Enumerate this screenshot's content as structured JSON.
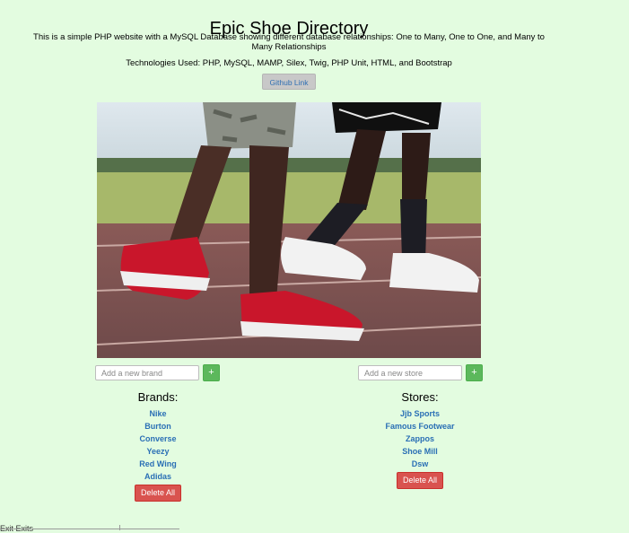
{
  "header": {
    "title": "Epic Shoe Directory",
    "description": "This is a simple PHP website with a MySQL Database showing different database relationships: One to Many, One to One, and Many to Many Relationships",
    "technologies": "Technologies Used: PHP, MySQL, MAMP, Silex, Twig, PHP Unit, HTML, and Bootstrap",
    "github_label": "Github Link"
  },
  "forms": {
    "brand_placeholder": "Add a new brand",
    "store_placeholder": "Add a new store",
    "add_label": "+"
  },
  "brands": {
    "heading": "Brands:",
    "items": [
      "Nike",
      "Burton",
      "Converse",
      "Yeezy",
      "Red Wing",
      "Adidas"
    ],
    "delete_label": "Delete All"
  },
  "stores": {
    "heading": "Stores:",
    "items": [
      "Jjb Sports",
      "Famous Footwear",
      "Zappos",
      "Shoe Mill",
      "Dsw"
    ],
    "delete_label": "Delete All"
  },
  "footer": {
    "partial_text": "Exit Exits"
  },
  "colors": {
    "background": "#e3fce0",
    "add_button": "#5cb85c",
    "delete_button": "#d9534f",
    "link": "#2a6fb5"
  }
}
